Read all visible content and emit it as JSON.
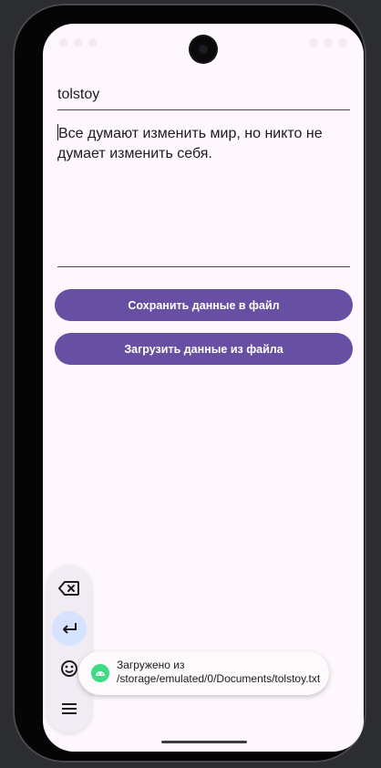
{
  "form": {
    "filename_value": "tolstoy",
    "content_value": "Все думают изменить мир, но никто не думает изменить себя."
  },
  "buttons": {
    "save_label": "Сохранить данные в файл",
    "load_label": "Загрузить данные из файла"
  },
  "keyboard_toolbar": {
    "icons": [
      "backspace-icon",
      "enter-icon",
      "emoji-icon",
      "menu-icon"
    ]
  },
  "toast": {
    "message": "Загружено из /storage/emulated/0/Documents/tolstoy.txt"
  },
  "colors": {
    "primary": "#6750a4",
    "background": "#fef7fd",
    "enter_highlight": "#d6e3ff",
    "android_green": "#3ddc84"
  }
}
